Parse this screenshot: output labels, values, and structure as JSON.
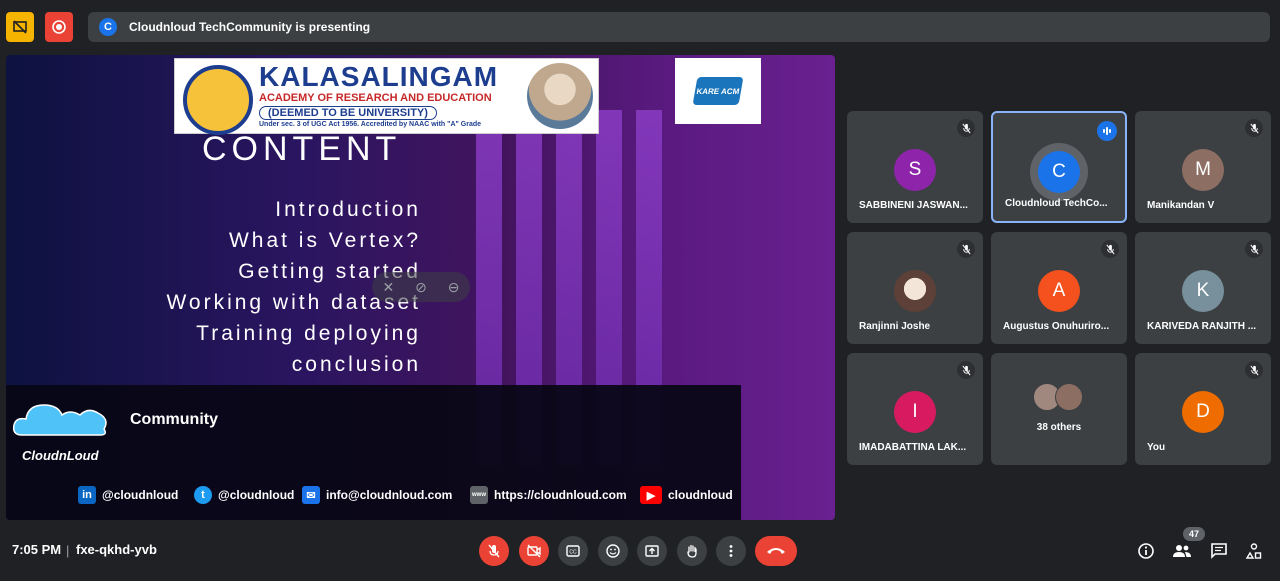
{
  "presenting_bar": {
    "avatar_letter": "C",
    "text": "Cloudnloud TechCommunity is presenting"
  },
  "slide": {
    "university_name": "KALASALINGAM",
    "university_sub1": "ACADEMY OF RESEARCH AND EDUCATION",
    "university_sub2": "(DEEMED TO BE UNIVERSITY)",
    "university_sub3": "Under sec. 3 of UGC Act 1956. Accredited by NAAC with \"A\" Grade",
    "acm_text": "KARE ACM",
    "heading": "CONTENT",
    "items": [
      "Introduction",
      "What is Vertex?",
      "Getting started",
      "Working with dataset",
      "Training deploying",
      "conclusion"
    ],
    "brand_name": "CloudnLoud",
    "community": "Community",
    "socials": [
      {
        "icon": "linkedin-icon",
        "label": "@cloudnloud",
        "color": "#0a66c2",
        "glyph": "in"
      },
      {
        "icon": "twitter-icon",
        "label": "@cloudnloud",
        "color": "#1d9bf0",
        "glyph": "t"
      },
      {
        "icon": "email-icon",
        "label": "info@cloudnloud.com",
        "color": "#1a73e8",
        "glyph": "✉"
      },
      {
        "icon": "web-icon",
        "label": "https://cloudnloud.com",
        "color": "#5f6368",
        "glyph": "www"
      },
      {
        "icon": "youtube-icon",
        "label": "cloudnloud",
        "color": "#ff0000",
        "glyph": "▶"
      }
    ]
  },
  "participants": [
    {
      "name": "SABBINENI JASWAN...",
      "letter": "S",
      "color": "#8e24aa",
      "state": "muted"
    },
    {
      "name": "Cloudnloud TechCo...",
      "letter": "C",
      "color": "#1a73e8",
      "state": "speaking"
    },
    {
      "name": "Manikandan V",
      "letter": "M",
      "color": "#8d6e63",
      "state": "muted"
    },
    {
      "name": "Ranjinni Joshe",
      "letter": "",
      "color": "#d7ccc8",
      "state": "muted"
    },
    {
      "name": "Augustus Onuhuriro...",
      "letter": "A",
      "color": "#f4511e",
      "state": "muted"
    },
    {
      "name": "KARIVEDA RANJITH ...",
      "letter": "K",
      "color": "#78909c",
      "state": "muted"
    },
    {
      "name": "IMADABATTINA LAK...",
      "letter": "I",
      "color": "#d81b60",
      "state": "muted"
    },
    {
      "name": "38 others",
      "letter": "",
      "color": "#5f6368",
      "state": "none"
    },
    {
      "name": "You",
      "letter": "D",
      "color": "#ef6c00",
      "state": "muted"
    }
  ],
  "bottom_bar": {
    "time": "7:05 PM",
    "separator": "|",
    "meeting_code": "fxe-qkhd-yvb",
    "people_count": "47"
  }
}
